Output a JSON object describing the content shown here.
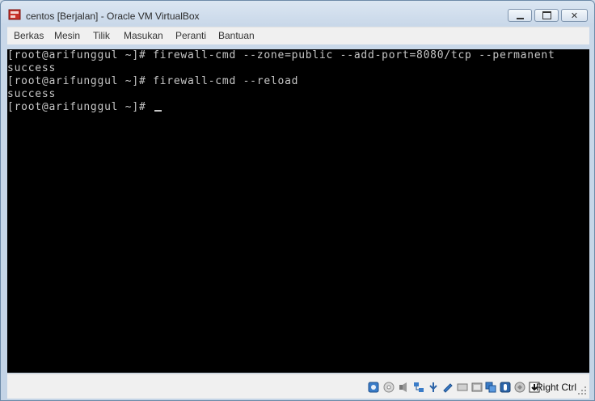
{
  "window": {
    "title": "centos [Berjalan] - Oracle VM VirtualBox",
    "controls": {
      "minimize": "▭",
      "maximize": "▢",
      "close": "✕"
    }
  },
  "menu": {
    "items": [
      "Berkas",
      "Mesin",
      "Tilik",
      "Masukan",
      "Peranti",
      "Bantuan"
    ]
  },
  "terminal": {
    "lines": [
      "[root@arifunggul ~]# firewall-cmd --zone=public --add-port=8080/tcp --permanent",
      "success",
      "[root@arifunggul ~]# firewall-cmd --reload",
      "success",
      "[root@arifunggul ~]# "
    ]
  },
  "statusbar": {
    "host_key": "Right Ctrl",
    "icons": [
      "hard-disk-icon",
      "optical-drive-icon",
      "audio-icon",
      "network-icon",
      "usb-icon",
      "shared-folders-icon",
      "display-icon",
      "video-capture-icon",
      "virtualization-icon",
      "mouse-integration-icon",
      "keyboard-icon"
    ]
  },
  "colors": {
    "terminal_bg": "#000000",
    "terminal_fg": "#c6c6c6",
    "frame": "#c4d4e6"
  }
}
